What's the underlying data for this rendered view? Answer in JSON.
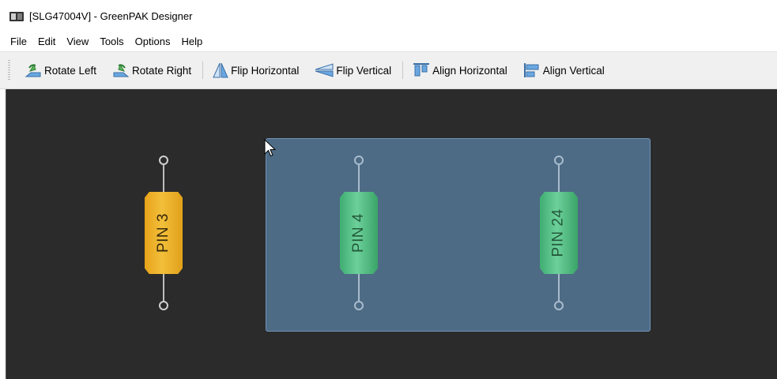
{
  "window": {
    "title": "[SLG47004V] - GreenPAK Designer",
    "icon": "greenpak-app-icon"
  },
  "menu": [
    "File",
    "Edit",
    "View",
    "Tools",
    "Options",
    "Help"
  ],
  "toolbar": {
    "rotate_left": "Rotate Left",
    "rotate_right": "Rotate Right",
    "flip_horizontal": "Flip Horizontal",
    "flip_vertical": "Flip Vertical",
    "align_horizontal": "Align Horizontal",
    "align_vertical": "Align Vertical"
  },
  "canvas": {
    "pins": [
      {
        "label": "PIN 3",
        "color": "#f0b12c",
        "selected": false
      },
      {
        "label": "PIN 4",
        "color": "#5bc48a",
        "selected": true
      },
      {
        "label": "PIN 24",
        "color": "#5bc48a",
        "selected": true
      }
    ],
    "background": "#2b2b2b",
    "selection_color": "#4d6b85"
  }
}
